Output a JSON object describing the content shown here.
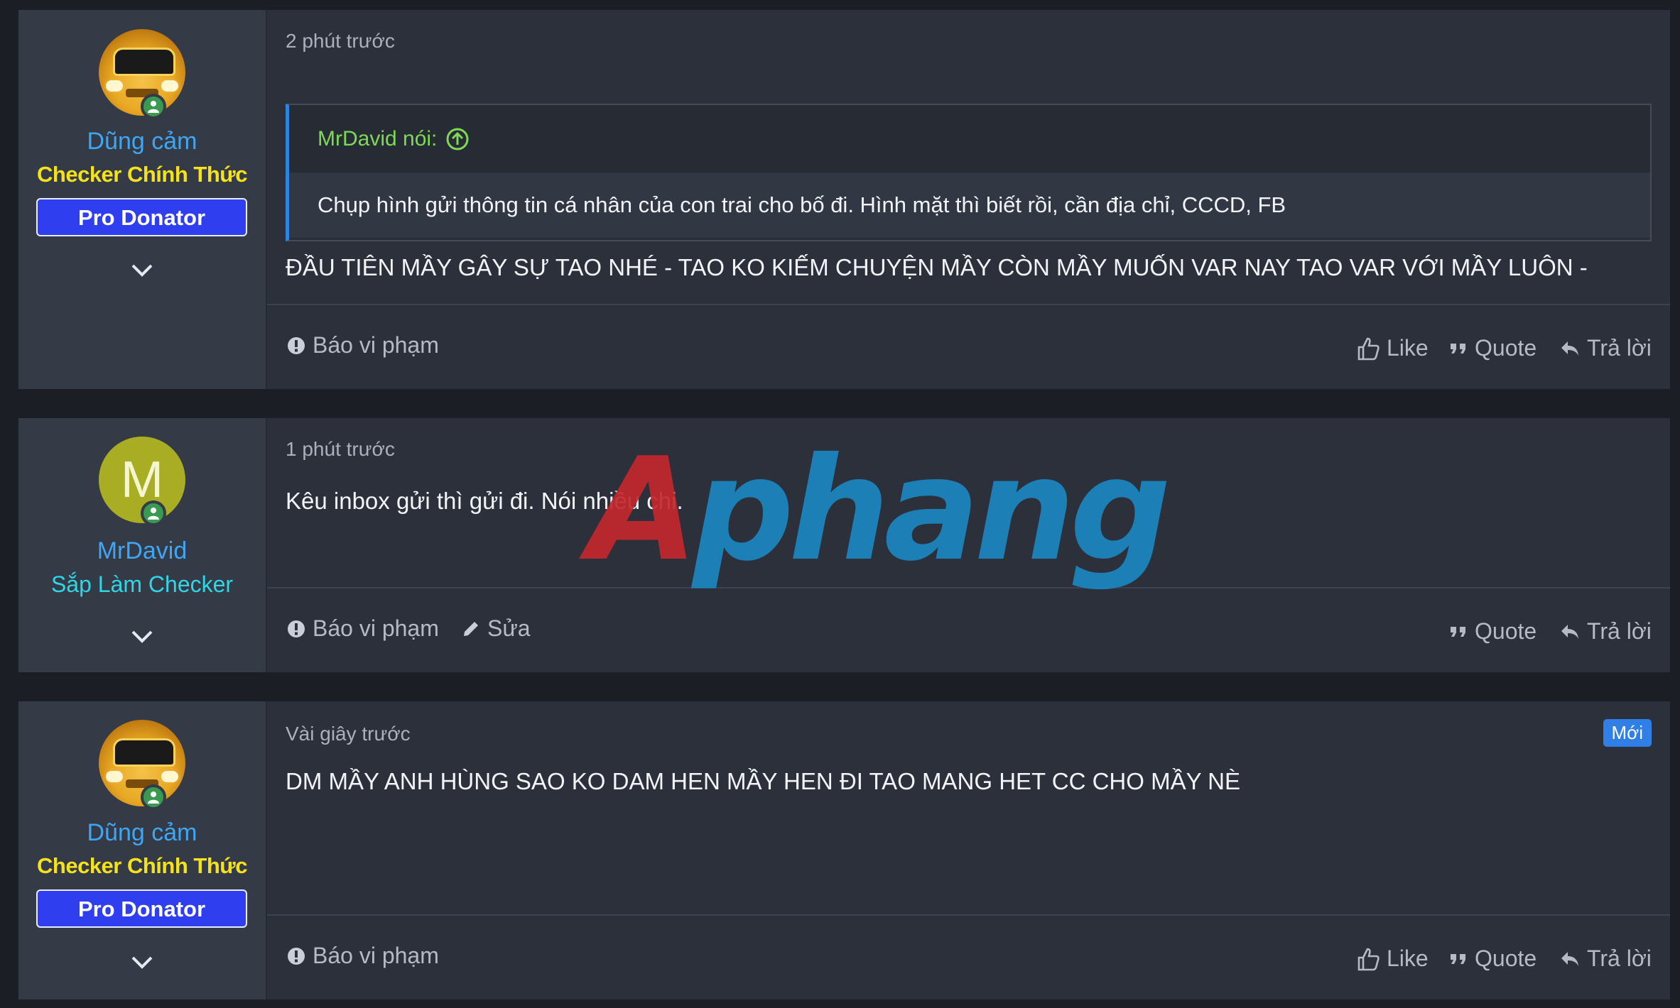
{
  "posts": [
    {
      "user": {
        "name": "Dũng cảm",
        "title": "Checker Chính Thức",
        "badge": "Pro Donator"
      },
      "time": "2 phút trước",
      "quote": {
        "author": "MrDavid nói:",
        "text": "Chụp hình gửi thông tin cá nhân của con trai cho bố đi. Hình mặt thì biết rồi, cần địa chỉ, CCCD, FB"
      },
      "body": "ĐẦU TIÊN MẦY GÂY SỰ TAO NHÉ - TAO KO KIẾM CHUYỆN MẦY CÒN MẦY MUỐN VAR NAY TAO VAR VỚI MẦY LUÔN -",
      "footer": {
        "report": "Báo vi phạm",
        "like": "Like",
        "quote": "Quote",
        "reply": "Trả lời"
      }
    },
    {
      "user": {
        "name": "MrDavid",
        "title": "Sắp Làm Checker",
        "avatar_letter": "M"
      },
      "time": "1 phút trước",
      "body": "Kêu inbox gửi thì gửi đi. Nói nhiều chi.",
      "footer": {
        "report": "Báo vi phạm",
        "edit": "Sửa",
        "quote": "Quote",
        "reply": "Trả lời"
      }
    },
    {
      "user": {
        "name": "Dũng cảm",
        "title": "Checker Chính Thức",
        "badge": "Pro Donator"
      },
      "time": "Vài giây trước",
      "new_badge": "Mới",
      "body": "DM MẦY ANH HÙNG SAO KO DAM HEN MẦY HEN ĐI TAO MANG HET CC CHO MẦY NÈ",
      "footer": {
        "report": "Báo vi phạm",
        "like": "Like",
        "quote": "Quote",
        "reply": "Trả lời"
      }
    }
  ],
  "watermark": {
    "part1": "A",
    "part2": "phang"
  },
  "colors": {
    "page_bg": "#1b1e25",
    "post_bg": "#2c303b",
    "user_col_bg": "#353a47",
    "username_blue": "#3ea6f2",
    "title_yellow": "#f5e21a",
    "title_cyan": "#2fd6e6",
    "quote_author_green": "#7ed957",
    "pro_badge": "#2f3ff0",
    "new_badge": "#2f7fe6"
  }
}
